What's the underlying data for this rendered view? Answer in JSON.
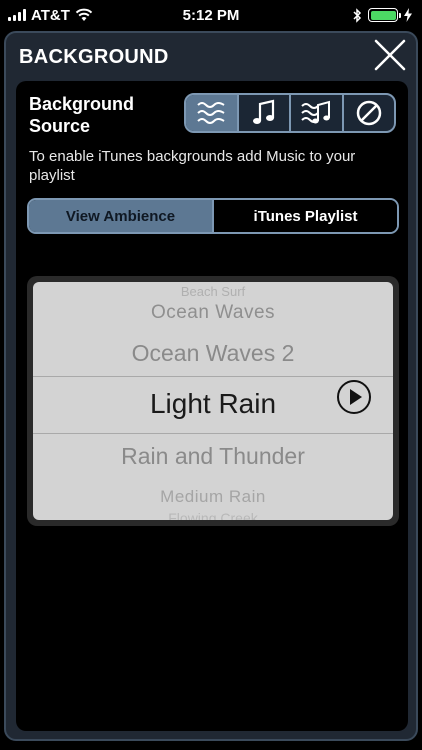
{
  "status": {
    "carrier": "AT&T",
    "time": "5:12 PM",
    "battery_level": 1.0,
    "icons": [
      "signal-icon",
      "wifi-icon",
      "bluetooth-icon",
      "battery-icon",
      "charging-icon"
    ]
  },
  "header": {
    "title": "BACKGROUND",
    "close_icon": "close-icon"
  },
  "source": {
    "label_line1": "Background",
    "label_line2": "Source",
    "options": [
      {
        "icon": "waves-icon",
        "selected": true
      },
      {
        "icon": "music-note-icon",
        "selected": false
      },
      {
        "icon": "waves-music-icon",
        "selected": false
      },
      {
        "icon": "none-icon",
        "selected": false
      }
    ]
  },
  "hint": "To enable iTunes backgrounds add Music to your playlist",
  "tabs": [
    {
      "label": "View Ambience",
      "active": true
    },
    {
      "label": "iTunes Playlist",
      "active": false
    }
  ],
  "picker": {
    "items": [
      "Beach Surf",
      "Ocean Waves",
      "Ocean Waves 2",
      "Light Rain",
      "Rain and Thunder",
      "Medium Rain",
      "Flowing Creek"
    ],
    "selected": "Light Rain"
  },
  "colors": {
    "accent": "#5d7893",
    "border": "#7d98b3",
    "battery": "#4cd964"
  }
}
